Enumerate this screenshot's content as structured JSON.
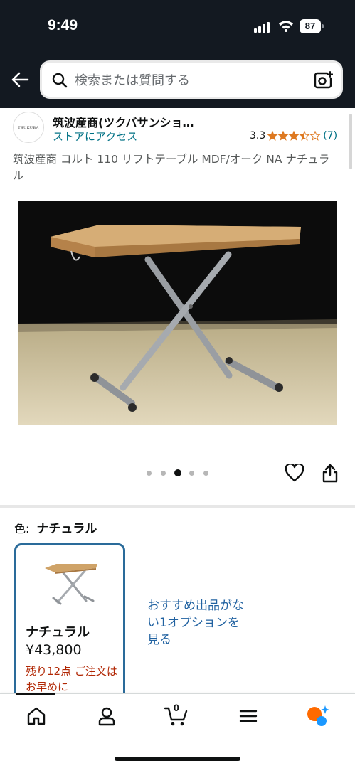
{
  "status_bar": {
    "time": "9:49",
    "battery": "87"
  },
  "search": {
    "placeholder": "検索または質問する"
  },
  "seller": {
    "logo_text": "TSUKUBA",
    "name": "筑波産商(ツクバサンショ…",
    "store_link": "ストアにアクセス",
    "rating": "3.3",
    "rating_count": "(7)",
    "stars_value": 3.5
  },
  "product": {
    "title": "筑波産商 コルト 110 リフトテーブル MDF/オーク NA ナチュラル",
    "image_count": 5,
    "active_image": 2
  },
  "variation": {
    "label": "色:",
    "selected": "ナチュラル",
    "options": [
      {
        "name": "ナチュラル",
        "price": "¥43,800",
        "stock": "残り12点 ご注文はお早めに"
      }
    ],
    "no_offer_text": "おすすめ出品がない1オプションを見る"
  },
  "bottom_nav": {
    "items": [
      "home-icon",
      "account-icon",
      "cart-icon",
      "menu-icon",
      "rufus-icon"
    ],
    "cart_count": "0",
    "active": 0
  },
  "colors": {
    "header_bg": "#131921",
    "link": "#007185",
    "link_alt": "#2162a1",
    "star": "#de7921",
    "urgent": "#b12704",
    "selected_border": "#2a6b9a",
    "rufus_orange": "#ff6a00",
    "rufus_blue": "#1a98ff"
  }
}
